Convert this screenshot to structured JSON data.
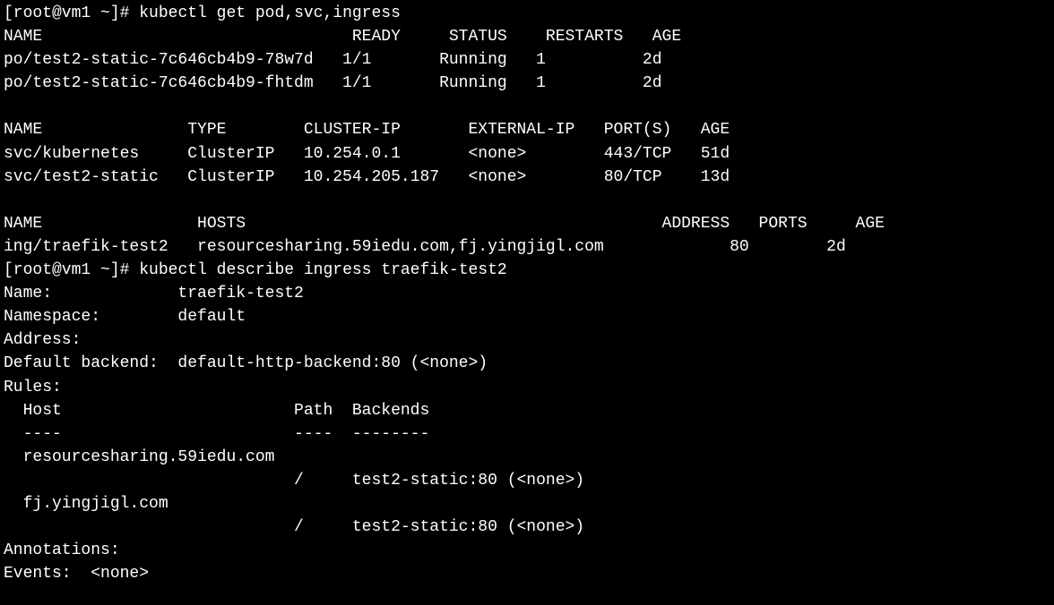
{
  "prompt1": "[root@vm1 ~]# ",
  "command1": "kubectl get pod,svc,ingress",
  "pods": {
    "header": "NAME                                READY     STATUS    RESTARTS   AGE",
    "rows": [
      "po/test2-static-7c646cb4b9-78w7d   1/1       Running   1          2d",
      "po/test2-static-7c646cb4b9-fhtdm   1/1       Running   1          2d"
    ]
  },
  "svcs": {
    "header": "NAME               TYPE        CLUSTER-IP       EXTERNAL-IP   PORT(S)   AGE",
    "rows": [
      "svc/kubernetes     ClusterIP   10.254.0.1       <none>        443/TCP   51d",
      "svc/test2-static   ClusterIP   10.254.205.187   <none>        80/TCP    13d"
    ]
  },
  "ings": {
    "header": "NAME                HOSTS                                           ADDRESS   PORTS     AGE",
    "rows": [
      "ing/traefik-test2   resourcesharing.59iedu.com,fj.yingjigl.com             80        2d"
    ]
  },
  "prompt2": "[root@vm1 ~]# ",
  "command2": "kubectl describe ingress traefik-test2",
  "describe": {
    "name": "Name:             traefik-test2",
    "namespace": "Namespace:        default",
    "address": "Address:          ",
    "default_backend": "Default backend:  default-http-backend:80 (<none>)",
    "rules_label": "Rules:",
    "rules_header": "  Host                        Path  Backends",
    "rules_divider": "  ----                        ----  --------",
    "host1": "  resourcesharing.59iedu.com  ",
    "backend1": "                              /     test2-static:80 (<none>)",
    "host2": "  fj.yingjigl.com             ",
    "backend2": "                              /     test2-static:80 (<none>)",
    "annotations": "Annotations:",
    "events": "Events:  <none>"
  }
}
